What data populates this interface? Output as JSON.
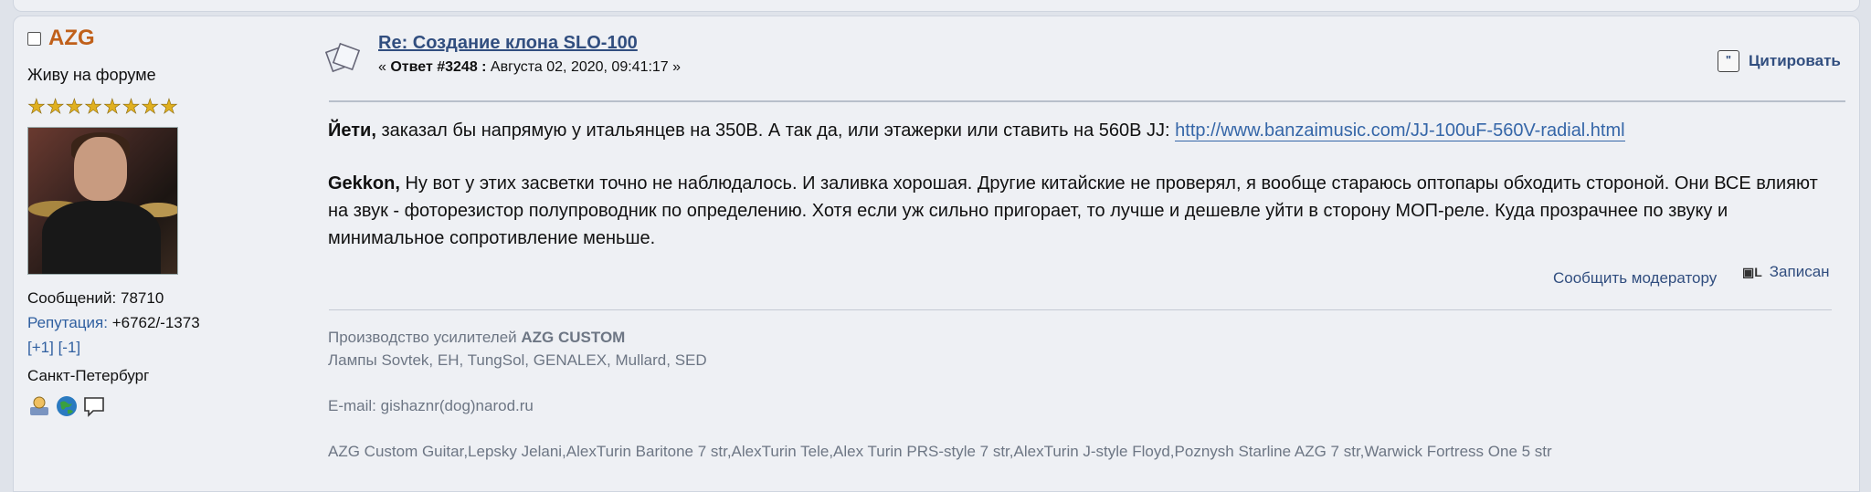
{
  "poster": {
    "name": "AZG",
    "group": "Живу на форуме",
    "stars": [
      "★",
      "★",
      "★",
      "★",
      "★",
      "★",
      "★",
      "★"
    ],
    "posts": "Сообщений: 78710",
    "reputation_label": "Репутация:",
    "reputation_value": "+6762/-1373",
    "rep_plus": "[+1]",
    "rep_minus": "[-1]",
    "city": "Санкт-Петербург",
    "icons": [
      "profile-icon",
      "website-icon",
      "message-icon"
    ]
  },
  "post": {
    "subject": "Re: Создание клона SLO-100",
    "reply_prefix": "« ",
    "reply_label": "Ответ #3248 :",
    "reply_date": " Августа 02, 2020, 09:41:17 »",
    "quote_label": "Цитировать",
    "p1_name": "Йети,",
    "p1_text": " заказал бы напрямую у итальянцев на 350В. А так да, или этажерки или ставить на 560В JJ: ",
    "p1_link": "http://www.banzaimusic.com/JJ-100uF-560V-radial.html",
    "p2_name": "Gekkon,",
    "p2_text": " Ну вот у этих засветки точно не наблюдалось. И заливка хорошая. Другие китайские не проверял, я вообще стараюсь оптопары обходить стороной. Они ВСЕ влияют на звук - фоторезистор полупроводник по определению. Хотя если уж сильно пригорает, то лучше и дешевле уйти в сторону МОП-реле. Куда прозрачнее по звуку и минимальное сопротивление меньше.",
    "report_label": "Сообщить модератору",
    "saved_label": "Записан"
  },
  "signature": {
    "line1_prefix": "Производство усилителей ",
    "line1_bold": "AZG CUSTOM",
    "line2": "Лампы Sovtek, EH, TungSol, GENALEX, Mullard, SED",
    "email": "E-mail: gishaznr(dog)narod.ru",
    "guitars": "AZG Custom Guitar,Lepsky Jelani,AlexTurin Baritone 7 str,AlexTurin Tele,Alex Turin PRS-style 7 str,AlexTurin J-style Floyd,Poznysh Starline AZG 7 str,Warwick Fortress One 5 str"
  }
}
